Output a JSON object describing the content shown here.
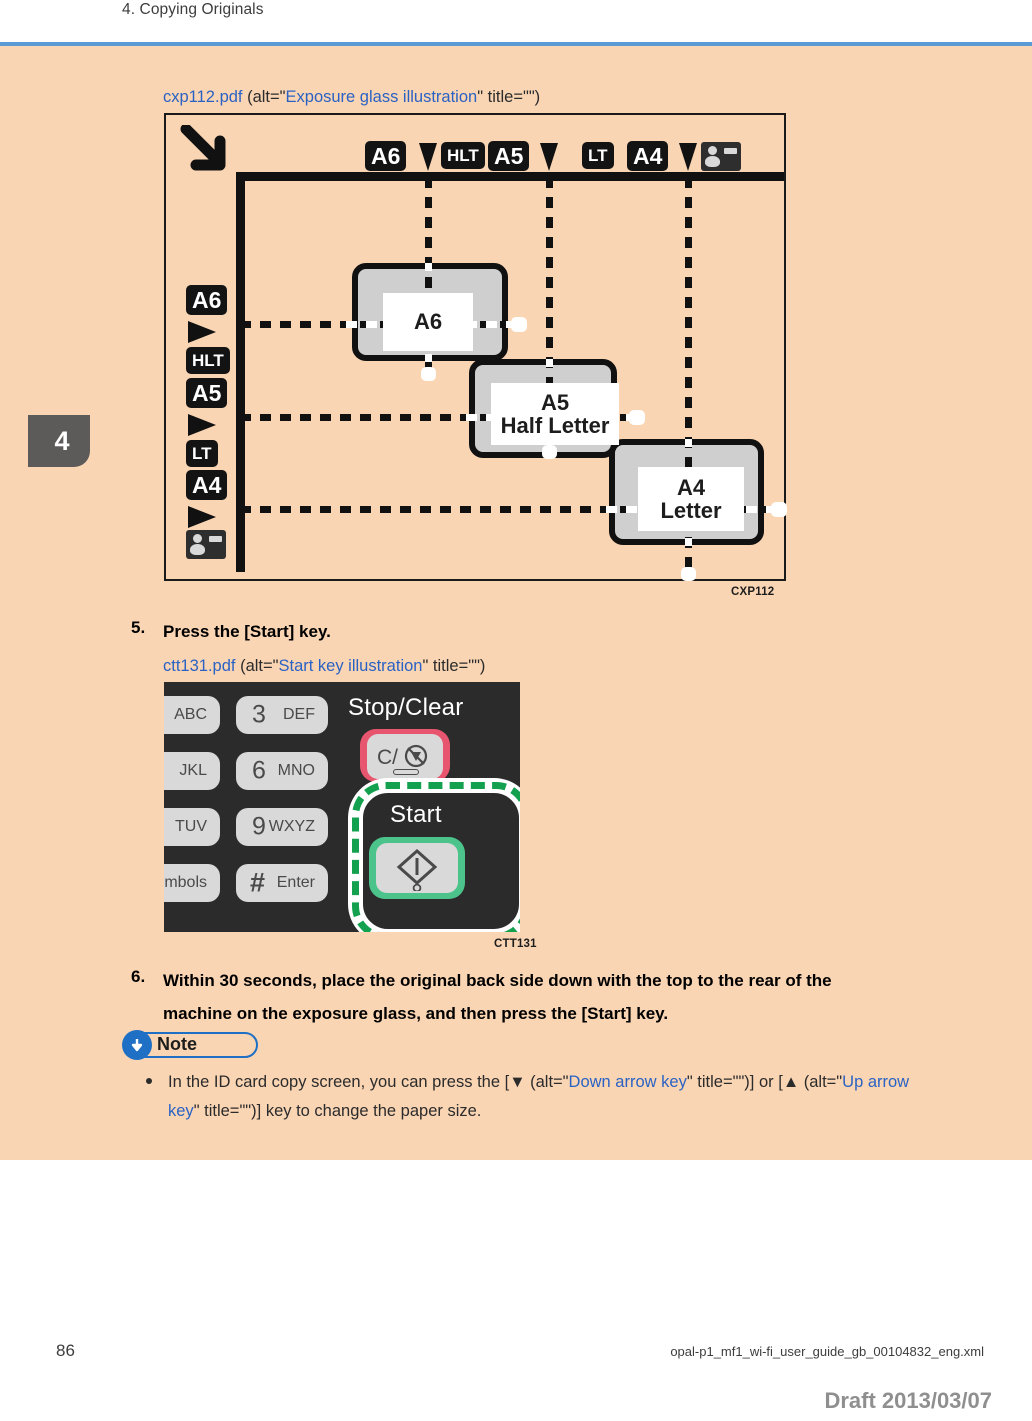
{
  "header": {
    "title": "4. Copying Originals",
    "rule_color": "#5b9bd5"
  },
  "chapter_tab": {
    "number": "4"
  },
  "figure1": {
    "caption_file": "cxp112.pdf",
    "caption_alt_open": " (alt=\"",
    "caption_alt": "Exposure glass illustration",
    "caption_alt_close": "\" title=\"\")",
    "figure_id": "CXP112",
    "top_ruler_labels": [
      "A6",
      "HLT",
      "A5",
      "LT",
      "A4"
    ],
    "top_icon": "id-card-icon",
    "left_ruler_labels": [
      "A6",
      "HLT",
      "A5",
      "LT",
      "A4"
    ],
    "left_icon": "id-card-icon",
    "sheets": [
      {
        "line1": "A6",
        "line2": ""
      },
      {
        "line1": "A5",
        "line2": "Half Letter"
      },
      {
        "line1": "A4",
        "line2": "Letter"
      }
    ],
    "corner_arrow": "down-right-arrow-icon"
  },
  "steps": [
    {
      "number": "5.",
      "text": "Press the [Start] key."
    },
    {
      "number": "6.",
      "line1": "Within 30 seconds, place the original back side down with the top to the rear of the",
      "line2": "machine on the exposure glass, and then press the [Start] key."
    }
  ],
  "figure2": {
    "caption_file": "ctt131.pdf",
    "caption_alt_open": " (alt=\"",
    "caption_alt": "Start key illustration",
    "caption_alt_close": "\" title=\"\")",
    "figure_id": "CTT131",
    "stop_clear_label": "Stop/Clear",
    "stop_clear_glyph": "C/⊘",
    "start_label": "Start",
    "start_glyph": "start-diamond-icon",
    "keys_partial": [
      "ABC",
      "JKL",
      "TUV",
      "mbols"
    ],
    "keys_full": [
      {
        "num": "3",
        "alpha": "DEF"
      },
      {
        "num": "6",
        "alpha": "MNO"
      },
      {
        "num": "9",
        "alpha": "WXYZ"
      },
      {
        "num": "#",
        "alpha": "Enter"
      }
    ],
    "colors": {
      "panel": "#2b2b2b",
      "key": "#d9d9d9",
      "stop_ring": "#e8556e",
      "start_ring": "#4cc38a",
      "highlight": "#13a14f"
    }
  },
  "note": {
    "badge_label": "Note",
    "badge_icon": "down-arrow-icon",
    "badge_color": "#1f6fc4",
    "text_part1": "In the ID card copy screen, you can press the [",
    "down_glyph": "▼",
    "text_part2": " (alt=\"",
    "down_alt": "Down arrow key",
    "text_part3": "\" title=\"\")] or [",
    "up_glyph": "▲",
    "text_part4": " (alt=\"",
    "up_alt": "Up arrow key",
    "text_part5": "\" title=\"\")] key to change the paper size."
  },
  "footer": {
    "page_number": "86",
    "file_name": "opal-p1_mf1_wi-fi_user_guide_gb_00104832_eng.xml",
    "draft": "Draft 2013/03/07"
  }
}
